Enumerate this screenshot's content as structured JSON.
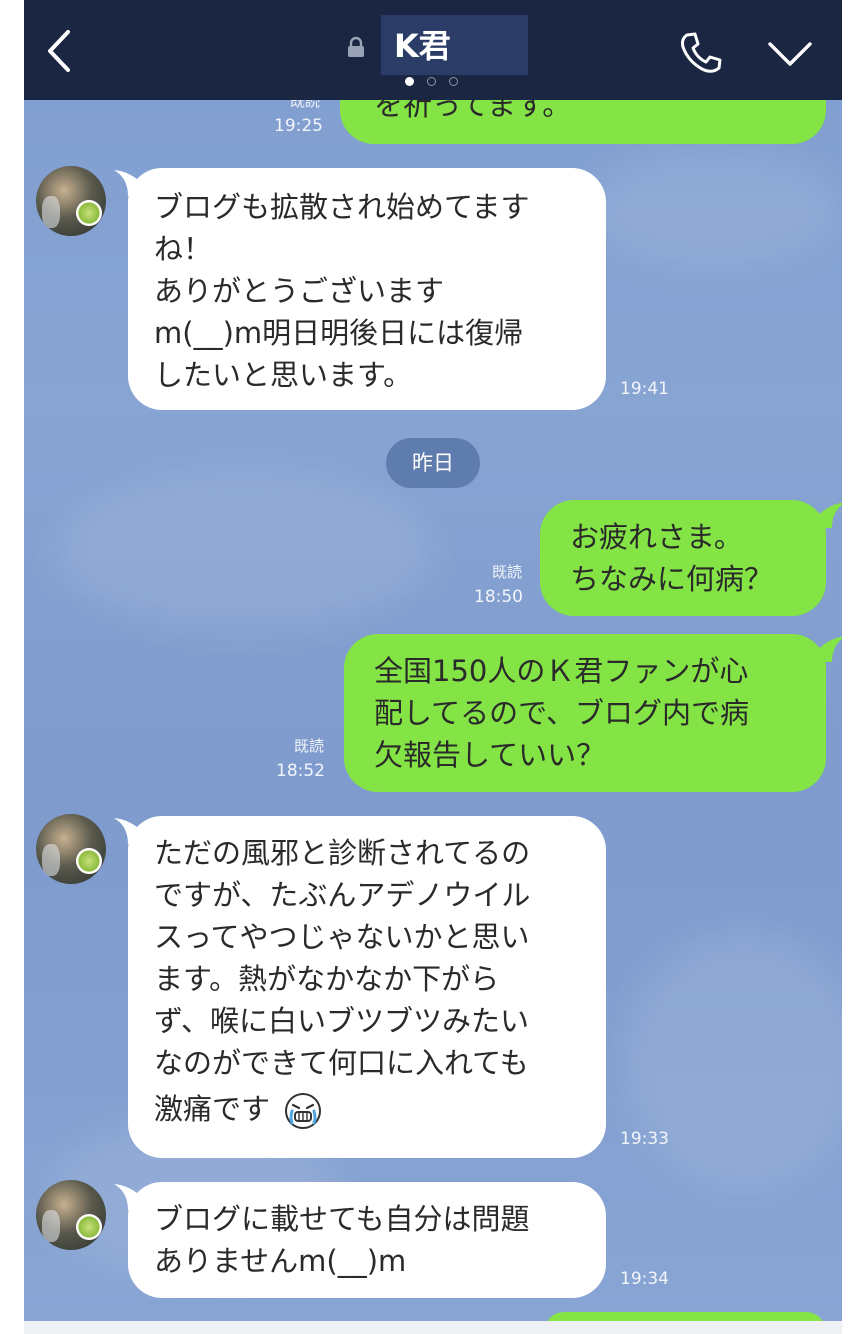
{
  "header": {
    "title": "K君",
    "back_icon": "chevron-left-icon",
    "lock_icon": "lock-icon",
    "call_icon": "phone-icon",
    "menu_icon": "chevron-down-icon",
    "page_indicator": {
      "count": 3,
      "active": 0
    }
  },
  "date_divider": "昨日",
  "messages": [
    {
      "side": "out",
      "text": "を祈ってます。",
      "read": "既読",
      "time": "19:25"
    },
    {
      "side": "in",
      "lines": [
        "ブログも拡散され始めてます",
        "ね！",
        "ありがとうございます",
        "m(__)m明日明後日には復帰",
        "したいと思います。"
      ],
      "time": "19:41"
    },
    {
      "side": "out",
      "lines": [
        "お疲れさま。",
        "ちなみに何病？"
      ],
      "read": "既読",
      "time": "18:50"
    },
    {
      "side": "out",
      "lines": [
        "全国150人のＫ君ファンが心",
        "配してるので、ブログ内で病",
        "欠報告していい？"
      ],
      "read": "既読",
      "time": "18:52"
    },
    {
      "side": "in",
      "lines": [
        "ただの風邪と診断されてるの",
        "ですが、たぶんアデノウイル",
        "スってやつじゃないかと思い",
        "ます。熱がなかなか下がら",
        "ず、喉に白いブツブツみたい",
        "なのができて何口に入れても",
        "激痛です"
      ],
      "sticker": "crying-face-icon",
      "time": "19:33"
    },
    {
      "side": "in",
      "lines": [
        "ブログに載せても自分は問題",
        "ありませんm(__)m"
      ],
      "time": "19:34"
    }
  ],
  "colors": {
    "header_bg": "#1b2742",
    "title_highlight": "#2b3d66",
    "chat_bg": "#84a1d1",
    "bubble_out": "#84e345",
    "bubble_in": "#ffffff",
    "date_pill": "#5f7cae"
  }
}
